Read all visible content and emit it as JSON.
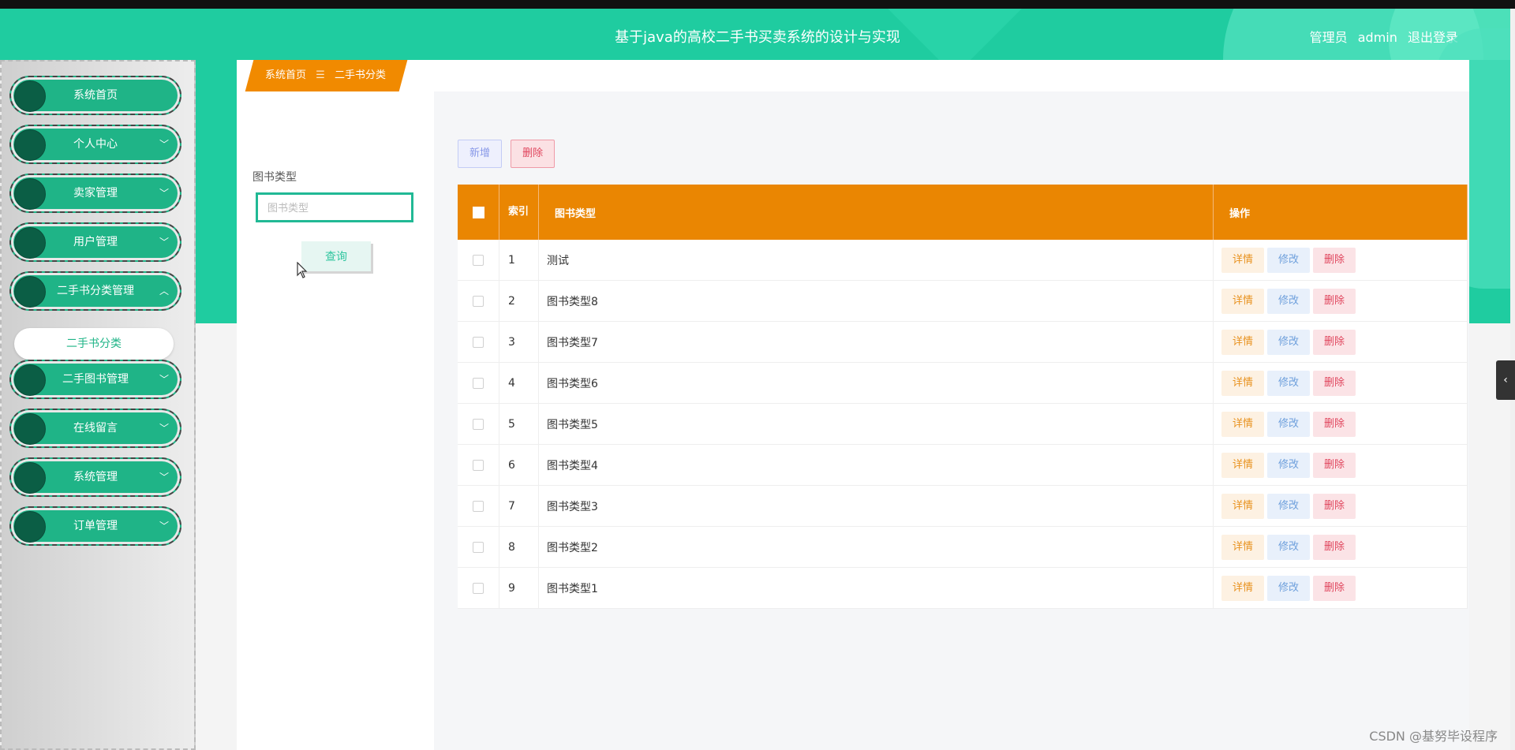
{
  "header": {
    "title": "基于java的高校二手书买卖系统的设计与实现",
    "role": "管理员",
    "username": "admin",
    "logout": "退出登录"
  },
  "sidebar": {
    "items": [
      {
        "label": "系统首页",
        "chevron": ""
      },
      {
        "label": "个人中心",
        "chevron": "﹀"
      },
      {
        "label": "卖家管理",
        "chevron": "﹀"
      },
      {
        "label": "用户管理",
        "chevron": "﹀"
      },
      {
        "label": "二手书分类管理",
        "chevron": "︿"
      },
      {
        "label": "二手图书管理",
        "chevron": "﹀"
      },
      {
        "label": "在线留言",
        "chevron": "﹀"
      },
      {
        "label": "系统管理",
        "chevron": "﹀"
      },
      {
        "label": "订单管理",
        "chevron": "﹀"
      }
    ],
    "submenu": {
      "label": "二手书分类"
    }
  },
  "breadcrumb": {
    "home": "系统首页",
    "separator": "☰",
    "current": "二手书分类"
  },
  "search": {
    "label": "图书类型",
    "placeholder": "图书类型",
    "button": "查询"
  },
  "toolbar": {
    "add": "新增",
    "delete": "删除"
  },
  "table": {
    "headers": {
      "index": "索引",
      "type": "图书类型",
      "actions": "操作"
    },
    "rows": [
      {
        "index": "1",
        "type": "测试"
      },
      {
        "index": "2",
        "type": "图书类型8"
      },
      {
        "index": "3",
        "type": "图书类型7"
      },
      {
        "index": "4",
        "type": "图书类型6"
      },
      {
        "index": "5",
        "type": "图书类型5"
      },
      {
        "index": "6",
        "type": "图书类型4"
      },
      {
        "index": "7",
        "type": "图书类型3"
      },
      {
        "index": "8",
        "type": "图书类型2"
      },
      {
        "index": "9",
        "type": "图书类型1"
      }
    ],
    "actions": {
      "detail": "详情",
      "edit": "修改",
      "delete": "删除"
    }
  },
  "side_tab": {
    "icon": "‹"
  },
  "watermark": "CSDN @基努毕设程序",
  "colors": {
    "primary": "#1fcca0",
    "menu": "#1fb487",
    "table_header": "#ea8602",
    "breadcrumb": "#f18a00"
  }
}
